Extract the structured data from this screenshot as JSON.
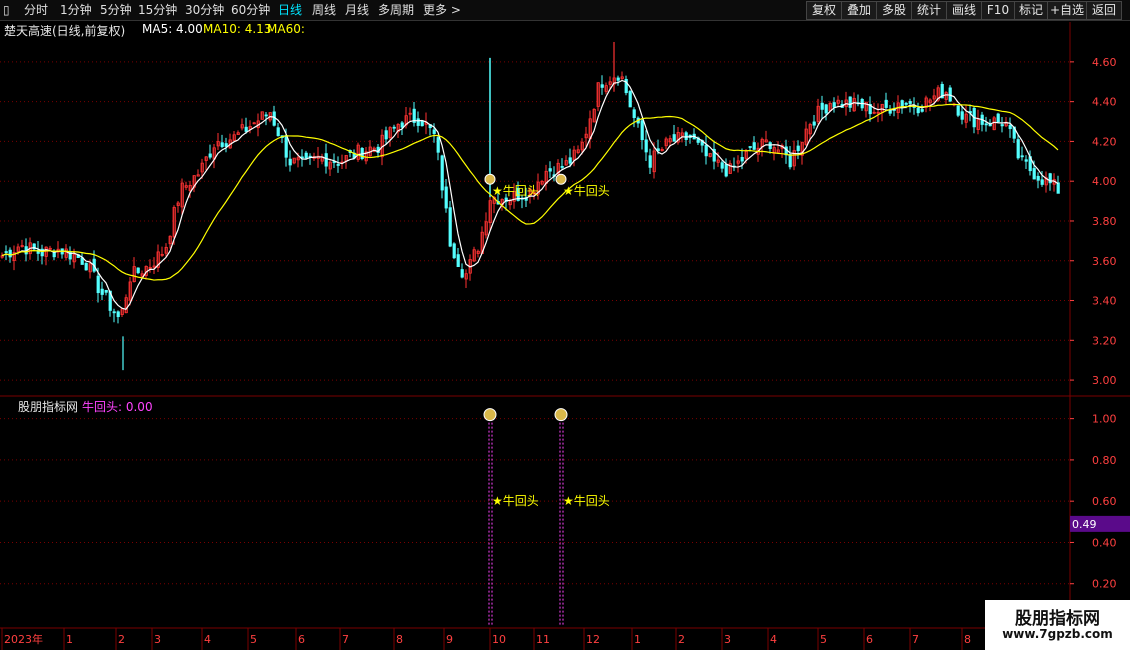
{
  "toolbar": {
    "periods": [
      "分时",
      "1分钟",
      "5分钟",
      "15分钟",
      "30分钟",
      "60分钟",
      "日线",
      "周线",
      "月线",
      "多周期",
      "更多 >"
    ],
    "active_period": "日线",
    "right_buttons": [
      "复权",
      "叠加",
      "多股",
      "统计",
      "画线",
      "F10",
      "标记",
      "+自选",
      "返回"
    ]
  },
  "main": {
    "stock_title": "楚天高速(日线,前复权)",
    "ma5": "MA5: 4.00",
    "ma10": "MA10: 4.13",
    "ma60": "MA60:",
    "price_ticks": [
      "4.60",
      "4.40",
      "4.20",
      "4.00",
      "3.80",
      "3.60",
      "3.40",
      "3.20",
      "3.00"
    ],
    "signal_label": "牛回头"
  },
  "indicator": {
    "name": "股朋指标网",
    "value": "牛回头: 0.00",
    "ticks": [
      "1.00",
      "0.80",
      "0.60",
      "0.40",
      "0.20"
    ],
    "cursor_value": "0.49",
    "signal_label": "牛回头"
  },
  "x_axis": {
    "labels": [
      "2023年",
      "1",
      "2",
      "3",
      "4",
      "5",
      "6",
      "7",
      "8",
      "9",
      "10",
      "11",
      "12",
      "1",
      "2",
      "3",
      "4",
      "5",
      "6",
      "7",
      "8"
    ]
  },
  "watermark": {
    "line1": "股朋指标网",
    "line2": "www.7gpzb.com"
  },
  "colors": {
    "up": "#ff3232",
    "down": "#54ffff",
    "ma5": "#ffffff",
    "ma10": "#ffff00",
    "grid": "#7a0000",
    "signal": "#ff44ff",
    "axis_text": "#ff4040"
  },
  "chart_data": {
    "type": "candlestick",
    "ylim": [
      2.92,
      4.72
    ],
    "indicator_ylim": [
      0,
      1.1
    ],
    "signals": [
      {
        "name": "牛回头",
        "value": 1.0
      },
      {
        "name": "牛回头",
        "value": 1.0
      }
    ]
  }
}
